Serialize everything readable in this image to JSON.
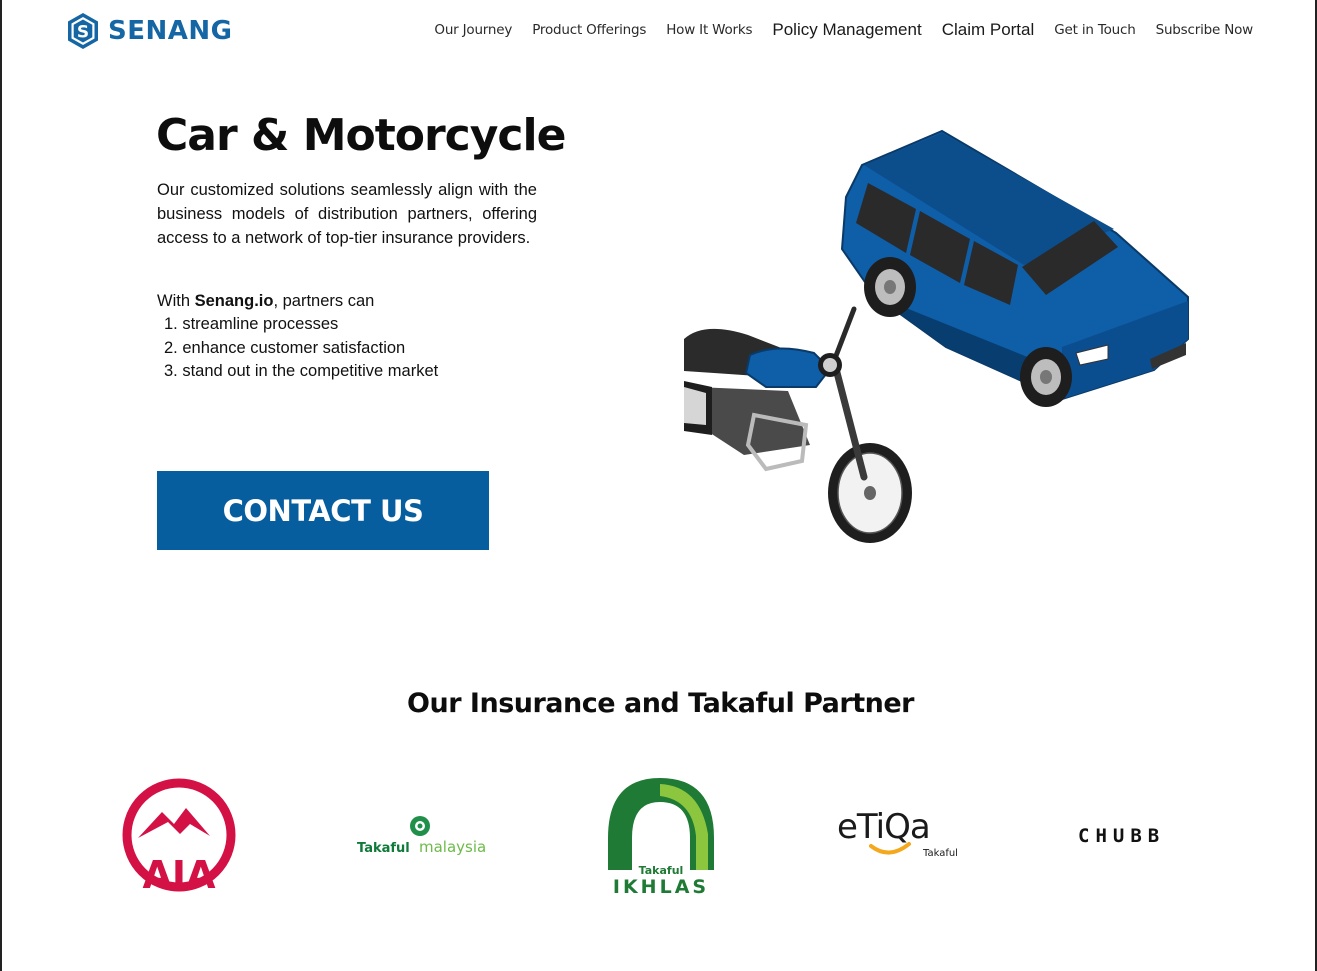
{
  "brand": {
    "name": "SENANG",
    "logo_letter": "S",
    "color": "#1566a4"
  },
  "nav": {
    "items": [
      {
        "label": "Our Journey"
      },
      {
        "label": "Product Offerings"
      },
      {
        "label": "How It Works"
      },
      {
        "label": "Policy Management"
      },
      {
        "label": "Claim Portal"
      },
      {
        "label": "Get in Touch"
      },
      {
        "label": "Subscribe Now"
      }
    ]
  },
  "hero": {
    "title": "Car & Motorcycle",
    "description": "Our customized solutions seamlessly align with the business models of distribution partners, offering access to a network of top-tier insurance providers.",
    "intro_prefix": "With ",
    "intro_brand": "Senang.io",
    "intro_suffix": ", partners can",
    "benefits": [
      "1. streamline processes",
      "2. enhance customer satisfaction",
      "3. stand out in the competitive market"
    ],
    "cta_label": "CONTACT US",
    "illustration_icon": "car-and-motorcycle-illustration"
  },
  "partners": {
    "heading": "Our Insurance and Takaful Partner",
    "logos": [
      {
        "name": "AIA",
        "color": "#d31145"
      },
      {
        "name": "Takaful",
        "name2": "malaysia",
        "color": "#0f7a3a"
      },
      {
        "name": "Takaful",
        "name2": "IKHLAS",
        "color": "#1e7a34"
      },
      {
        "name": "eTiQa",
        "name2": "Takaful",
        "color": "#f4a81d"
      },
      {
        "name": "CHUBB",
        "color": "#111111"
      }
    ]
  },
  "colors": {
    "primary": "#075e9e",
    "car_blue": "#0f5ea8"
  }
}
